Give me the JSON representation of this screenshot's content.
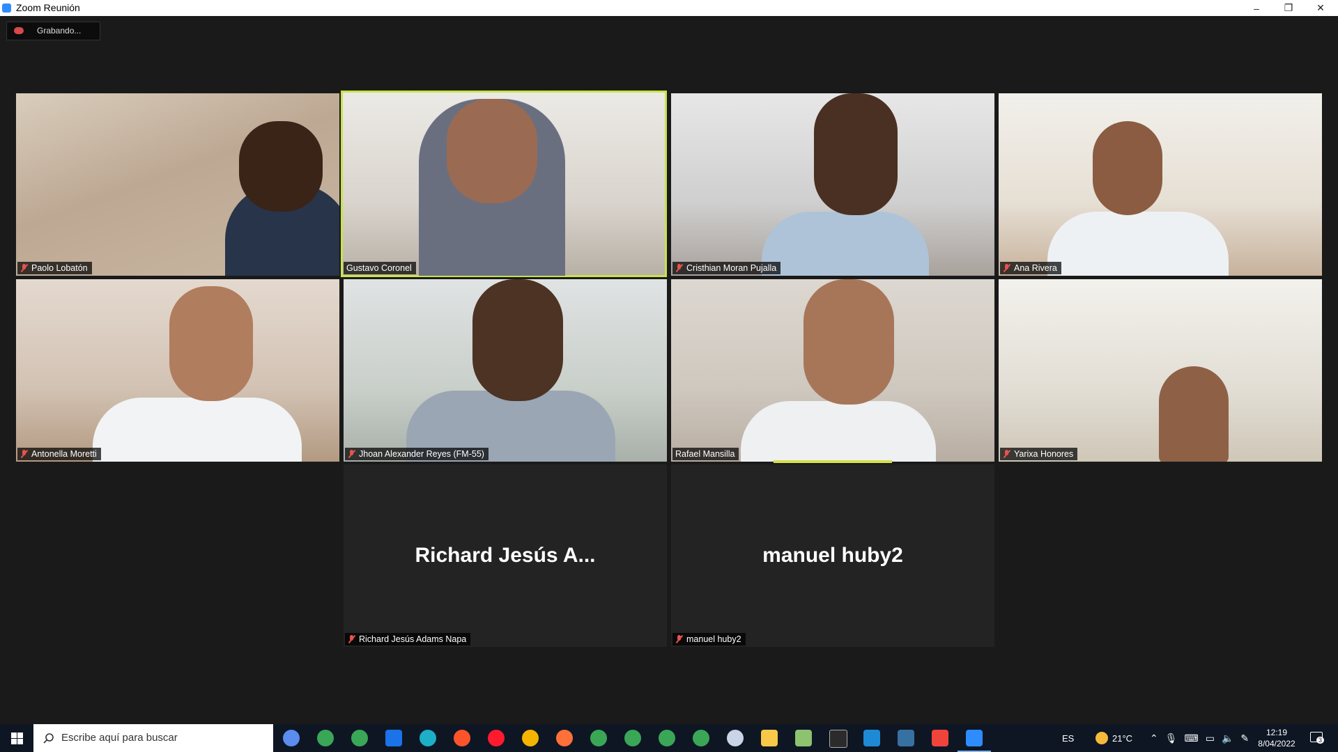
{
  "window": {
    "title": "Zoom Reunión",
    "minimize": "–",
    "restore": "❐",
    "close": "✕"
  },
  "recording": {
    "label": "Grabando..."
  },
  "participants": [
    {
      "name": "Paolo Lobatón",
      "muted": true,
      "speaking": false
    },
    {
      "name": "Gustavo Coronel",
      "muted": false,
      "speaking": true
    },
    {
      "name": "Cristhian Moran Pujalla",
      "muted": true,
      "speaking": false
    },
    {
      "name": "Ana Rivera",
      "muted": true,
      "speaking": false
    },
    {
      "name": "Antonella Moretti",
      "muted": true,
      "speaking": false
    },
    {
      "name": "Jhoan Alexander Reyes (FM-55)",
      "muted": true,
      "speaking": false
    },
    {
      "name": "Rafael Mansilla",
      "muted": false,
      "speaking": false
    },
    {
      "name": "Yarixa Honores",
      "muted": true,
      "speaking": false
    },
    {
      "name": "Richard Jesús Adams Napa",
      "display": "Richard Jesús A...",
      "muted": true,
      "video": false
    },
    {
      "name": "manuel huby2",
      "display": "manuel huby2",
      "muted": true,
      "video": false
    }
  ],
  "taskbar": {
    "search_placeholder": "Escribe aquí para buscar",
    "language": "ES",
    "temperature": "21°C",
    "time": "12:19",
    "date": "8/04/2022",
    "notifications": "3",
    "app_icons": [
      "cortana-icon",
      "chrome-icon",
      "chrome-icon",
      "mail-icon",
      "edge-icon",
      "brave-icon",
      "opera-icon",
      "vpn-icon",
      "firefox-icon",
      "chrome-icon",
      "chrome-icon",
      "chrome-icon",
      "chrome-icon",
      "paint-icon",
      "file-explorer-icon",
      "notepad-icon",
      "terminal-icon",
      "vscode-icon",
      "python-icon",
      "anydesk-icon",
      "zoom-icon"
    ]
  },
  "colors": {
    "speaking_border": "#c8e34c",
    "muted_icon": "#e8534e",
    "background": "#1a1a1a"
  }
}
